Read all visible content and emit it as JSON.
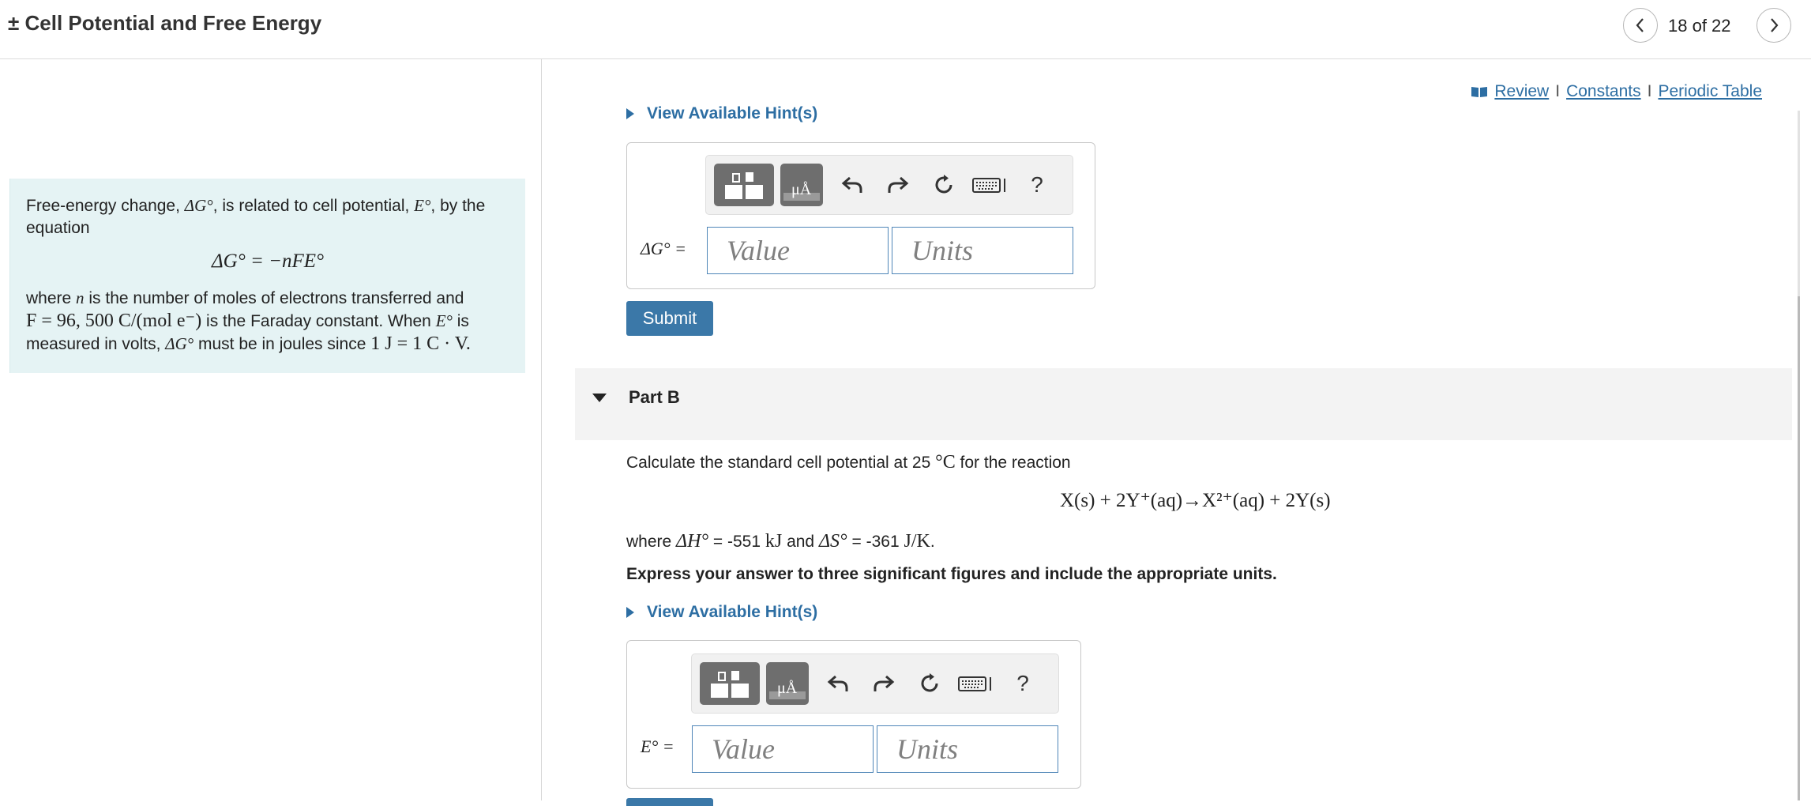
{
  "header": {
    "title": "± Cell Potential and Free Energy",
    "page_counter": "18 of 22"
  },
  "info": {
    "line1_pre": "Free-energy change, ",
    "dG": "ΔG°",
    "line1_mid": ", is related to cell potential, ",
    "E": "E°",
    "line1_post": ", by the equation",
    "equation": "ΔG° = −nFE°",
    "where_pre": "where ",
    "n": "n",
    "where_post": " is the number of moles of electrons transferred and",
    "faraday": "F = 96, 500 C/(mol e⁻)",
    "faraday_post": " is the Faraday constant. When ",
    "E2": "E°",
    "is_text": " is",
    "measured_pre": "measured in volts, ",
    "dG2": "ΔG°",
    "measured_mid": " must be in joules since ",
    "joule": "1 J = 1 C · V."
  },
  "resources": {
    "review": "Review",
    "constants": "Constants",
    "periodic_table": "Periodic Table",
    "separator": "I"
  },
  "part_a": {
    "hint": "View Available Hint(s)",
    "field_label": "ΔG° =",
    "value_placeholder": "Value",
    "units_placeholder": "Units",
    "submit": "Submit"
  },
  "part_b": {
    "title": "Part B",
    "intro_pre": "Calculate the standard cell potential at 25 ",
    "temp_unit": "°C",
    "intro_post": " for the reaction",
    "reaction": "X(s) + 2Y⁺(aq)→X²⁺(aq) + 2Y(s)",
    "where_text": "where",
    "dH": "ΔH°",
    "dH_val": "= -551",
    "kJ": "kJ",
    "and_text": "and",
    "dS": "ΔS°",
    "dS_val": "= -361",
    "JK": "J/K",
    "period": ".",
    "instruction": "Express your answer to three significant figures and include the appropriate units.",
    "hint": "View Available Hint(s)",
    "field_label": "E° =",
    "value_placeholder": "Value",
    "units_placeholder": "Units"
  },
  "toolbar": {
    "icons": [
      "templates-icon",
      "symbols-icon",
      "undo-icon",
      "redo-icon",
      "reset-icon",
      "keyboard-icon",
      "help-icon"
    ],
    "help": "?",
    "symbols_glyph": "μÅ"
  },
  "colors": {
    "link": "#2d6ea3",
    "info_bg": "#e5f3f4",
    "submit_bg": "#3b78a8",
    "input_border": "#4f86b8"
  }
}
